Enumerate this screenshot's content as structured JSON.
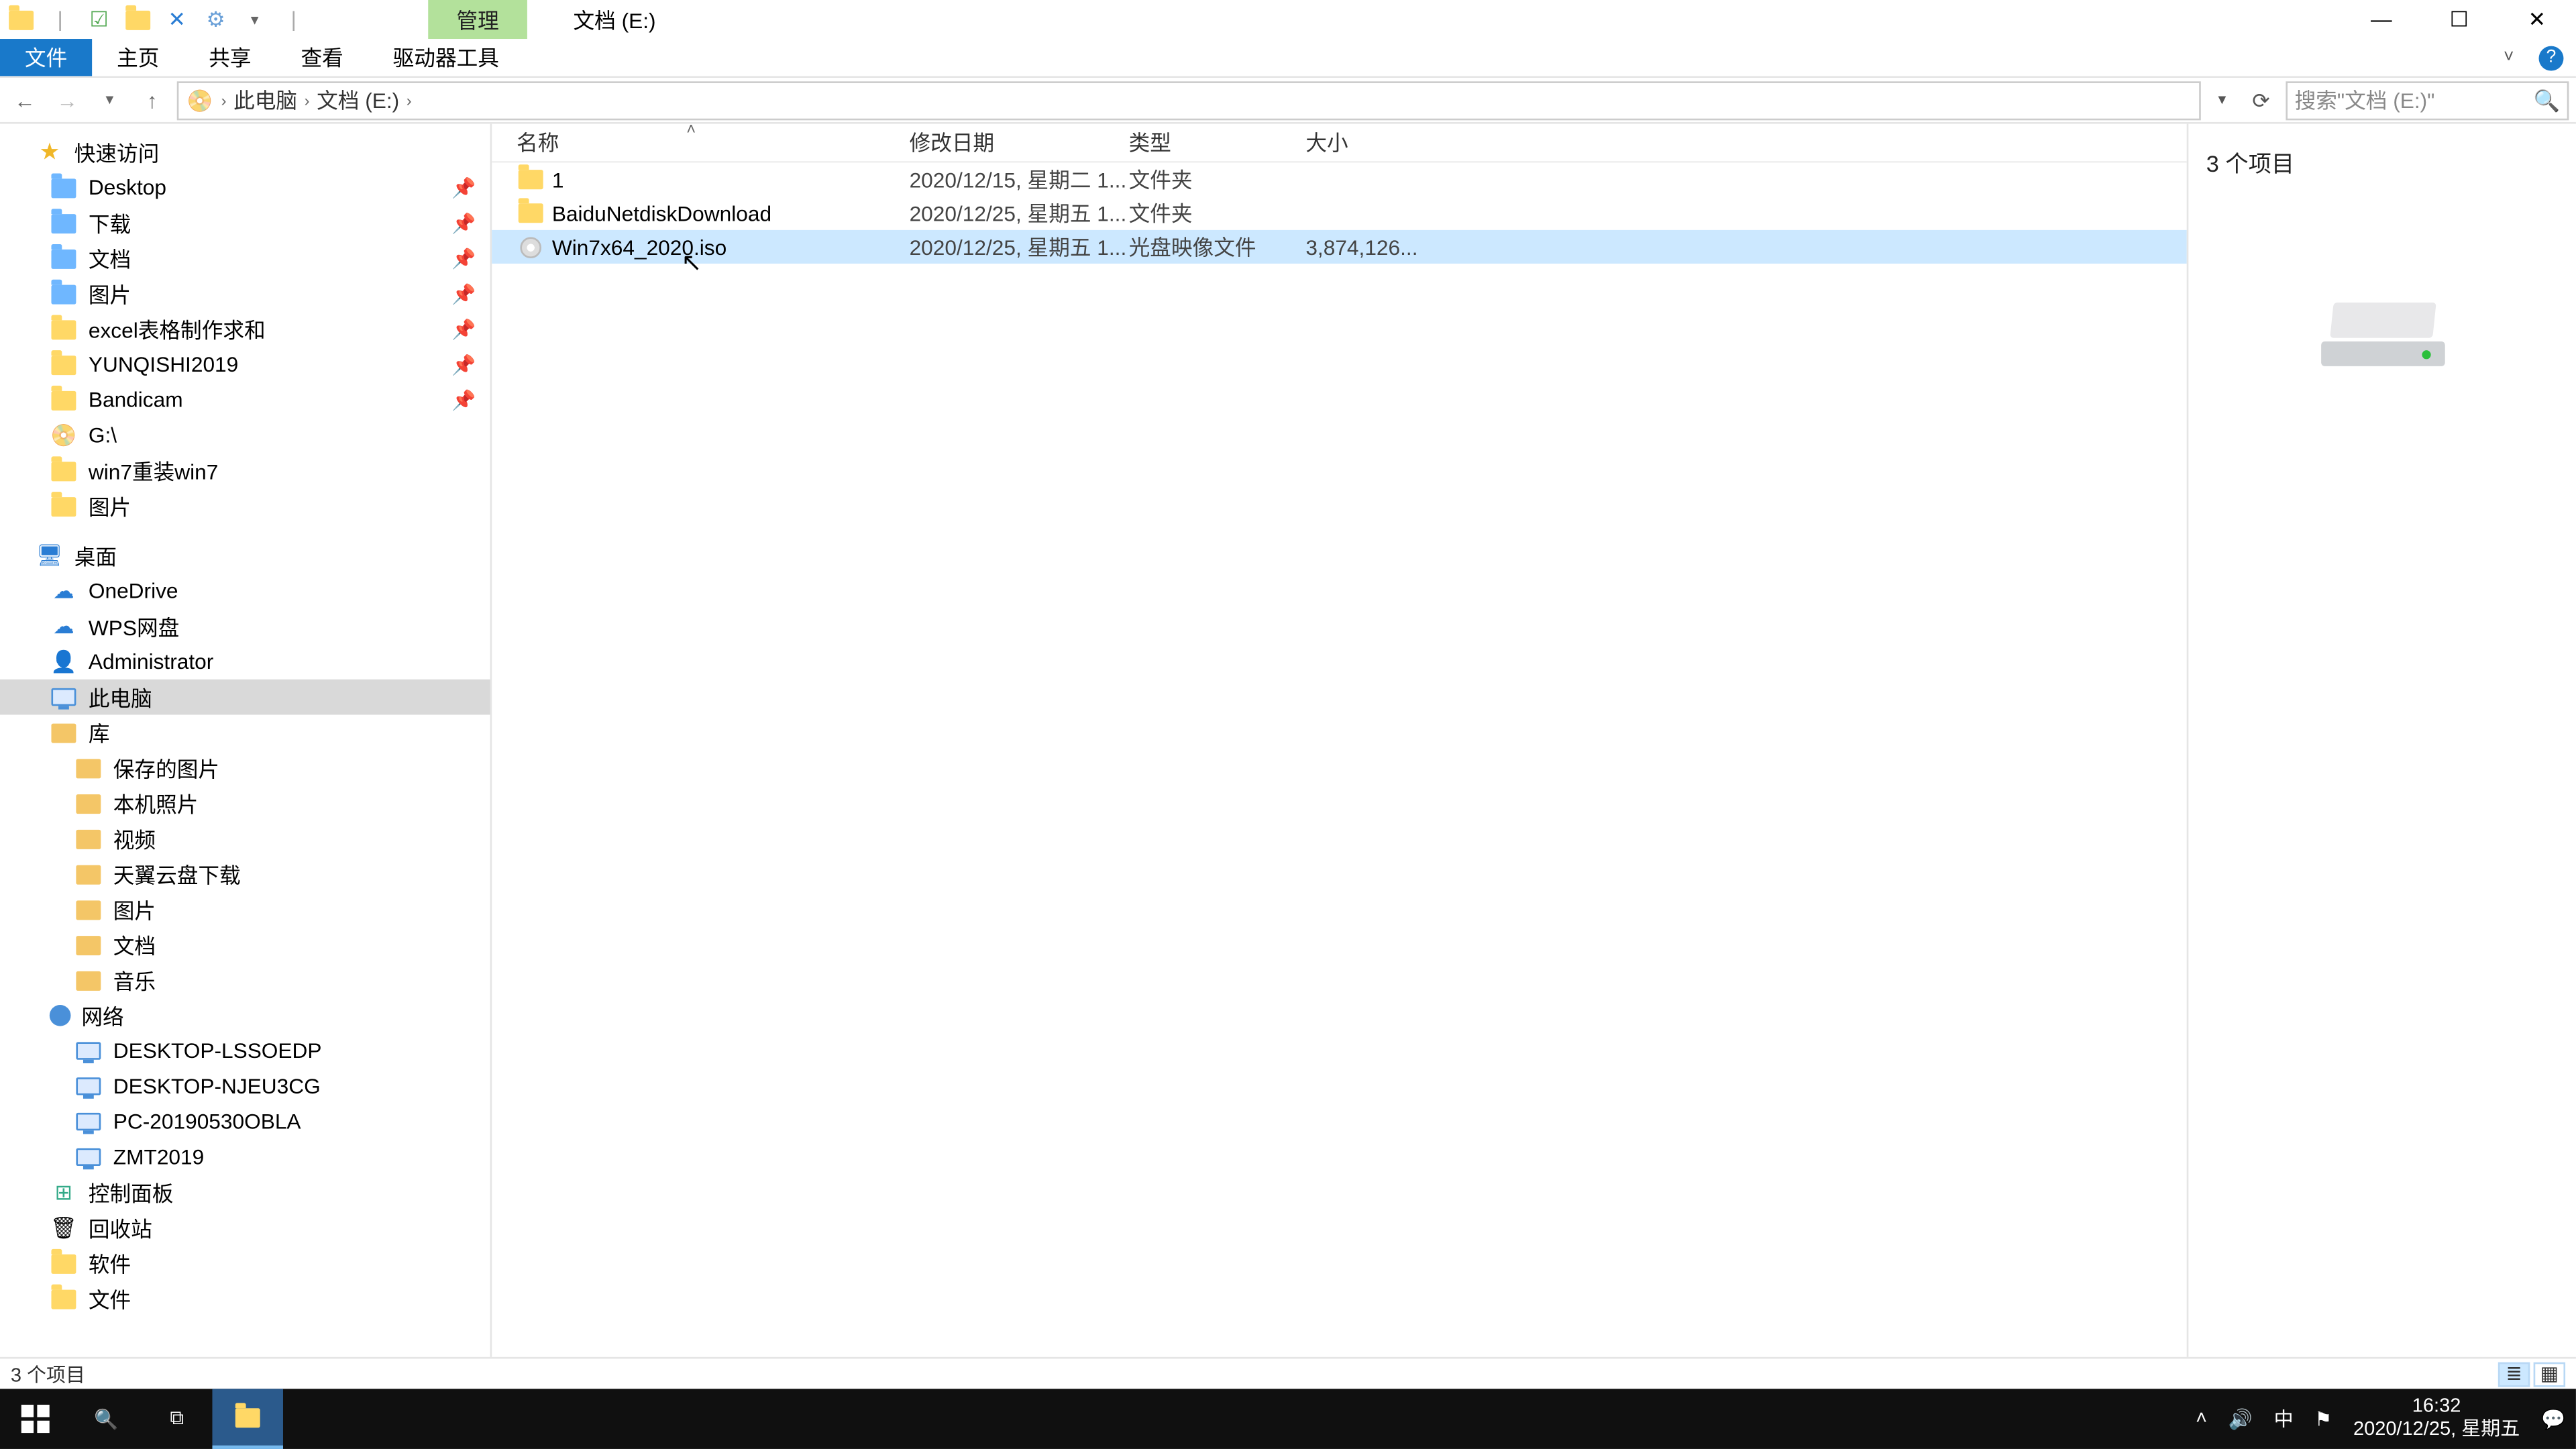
{
  "title": {
    "context_tab": "管理",
    "location_tab": "文档 (E:)"
  },
  "ribbon": {
    "file": "文件",
    "home": "主页",
    "share": "共享",
    "view": "查看",
    "drive_tools": "驱动器工具"
  },
  "nav": {
    "breadcrumb": {
      "pc": "此电脑",
      "drive": "文档 (E:)"
    },
    "search_placeholder": "搜索\"文档 (E:)\""
  },
  "columns": {
    "name": "名称",
    "date": "修改日期",
    "type": "类型",
    "size": "大小"
  },
  "rows": [
    {
      "name": "1",
      "date": "2020/12/15, 星期二 1...",
      "type": "文件夹",
      "size": "",
      "icon": "folder"
    },
    {
      "name": "BaiduNetdiskDownload",
      "date": "2020/12/25, 星期五 1...",
      "type": "文件夹",
      "size": "",
      "icon": "folder"
    },
    {
      "name": "Win7x64_2020.iso",
      "date": "2020/12/25, 星期五 1...",
      "type": "光盘映像文件",
      "size": "3,874,126...",
      "icon": "disc",
      "selected": true
    }
  ],
  "preview": {
    "count_label": "3 个项目"
  },
  "tree": {
    "quick_access": "快速访问",
    "qa_items": [
      {
        "label": "Desktop",
        "icon": "blue-folder"
      },
      {
        "label": "下载",
        "icon": "blue-folder"
      },
      {
        "label": "文档",
        "icon": "blue-folder"
      },
      {
        "label": "图片",
        "icon": "blue-folder"
      },
      {
        "label": "excel表格制作求和",
        "icon": "folder"
      },
      {
        "label": "YUNQISHI2019",
        "icon": "folder"
      },
      {
        "label": "Bandicam",
        "icon": "folder"
      },
      {
        "label": "G:\\",
        "icon": "drive"
      },
      {
        "label": "win7重装win7",
        "icon": "folder"
      },
      {
        "label": "图片",
        "icon": "folder"
      }
    ],
    "desktop": "桌面",
    "desk_items": [
      {
        "label": "OneDrive",
        "icon": "cloud"
      },
      {
        "label": "WPS网盘",
        "icon": "cloud"
      },
      {
        "label": "Administrator",
        "icon": "user"
      },
      {
        "label": "此电脑",
        "icon": "pc",
        "selected": true
      },
      {
        "label": "库",
        "icon": "lib"
      }
    ],
    "lib_items": [
      {
        "label": "保存的图片"
      },
      {
        "label": "本机照片"
      },
      {
        "label": "视频"
      },
      {
        "label": "天翼云盘下载"
      },
      {
        "label": "图片"
      },
      {
        "label": "文档"
      },
      {
        "label": "音乐"
      }
    ],
    "network": "网络",
    "net_items": [
      {
        "label": "DESKTOP-LSSOEDP"
      },
      {
        "label": "DESKTOP-NJEU3CG"
      },
      {
        "label": "PC-20190530OBLA"
      },
      {
        "label": "ZMT2019"
      }
    ],
    "control_panel": "控制面板",
    "recycle": "回收站",
    "software": "软件",
    "documents": "文件"
  },
  "status": {
    "text": "3 个项目"
  },
  "taskbar": {
    "time": "16:32",
    "date": "2020/12/25, 星期五",
    "ime": "中"
  }
}
